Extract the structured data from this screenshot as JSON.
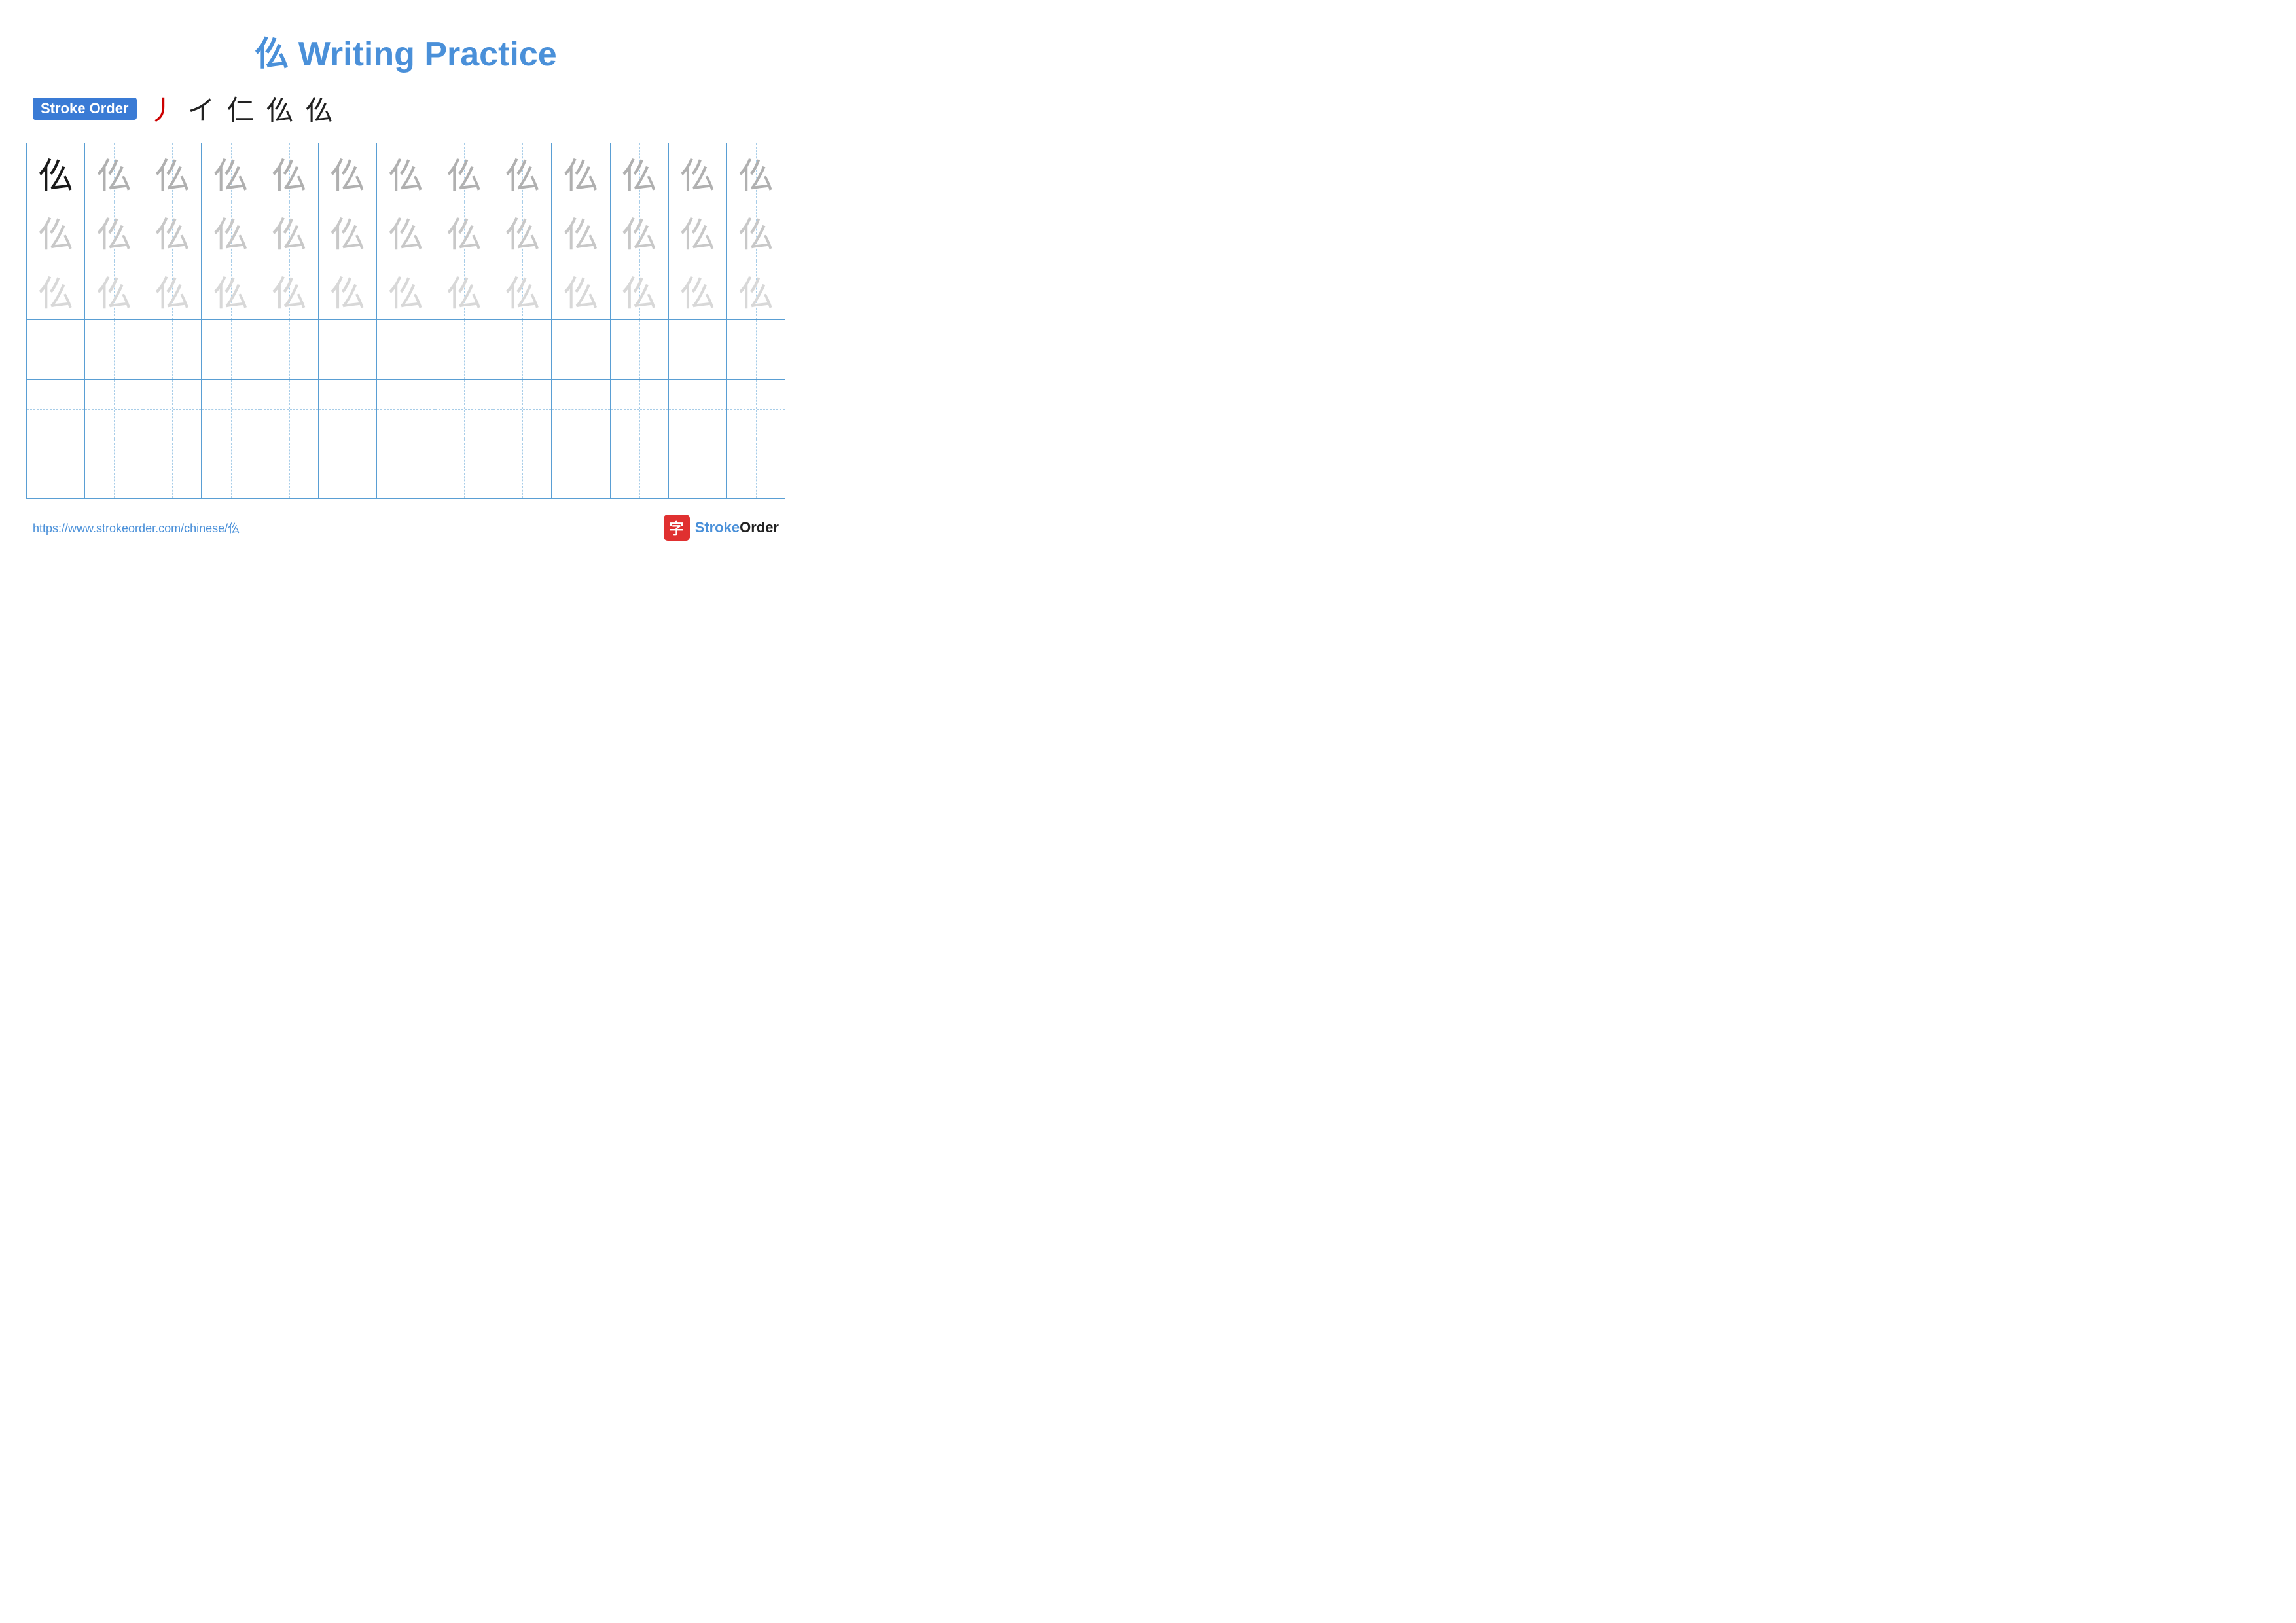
{
  "title": {
    "char": "仫",
    "label": "Writing Practice",
    "full": "仫 Writing Practice"
  },
  "stroke_order": {
    "badge_label": "Stroke Order",
    "strokes": [
      "丿",
      "イ",
      "仁",
      "仫",
      "仫"
    ]
  },
  "grid": {
    "cols": 13,
    "rows": [
      {
        "type": "dark-fading",
        "chars": [
          "dark",
          "light1",
          "light1",
          "light1",
          "light1",
          "light1",
          "light1",
          "light1",
          "light1",
          "light1",
          "light1",
          "light1",
          "light1"
        ]
      },
      {
        "type": "light",
        "chars": [
          "light2",
          "light2",
          "light2",
          "light2",
          "light2",
          "light2",
          "light2",
          "light2",
          "light2",
          "light2",
          "light2",
          "light2",
          "light2"
        ]
      },
      {
        "type": "lighter",
        "chars": [
          "light3",
          "light3",
          "light3",
          "light3",
          "light3",
          "light3",
          "light3",
          "light3",
          "light3",
          "light3",
          "light3",
          "light3",
          "light3"
        ]
      },
      {
        "type": "empty"
      },
      {
        "type": "empty"
      },
      {
        "type": "empty"
      }
    ],
    "character": "仫"
  },
  "footer": {
    "url": "https://www.strokeorder.com/chinese/仫",
    "brand_icon": "字",
    "brand_name": "StrokeOrder"
  }
}
